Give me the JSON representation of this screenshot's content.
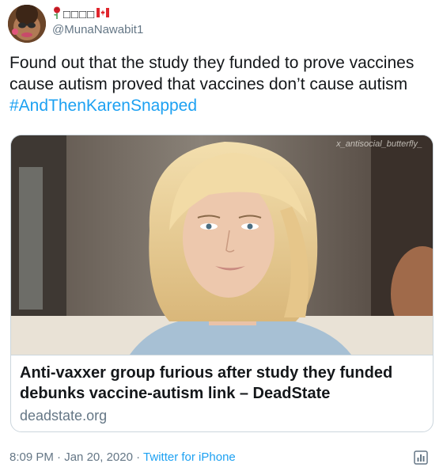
{
  "author": {
    "display_name": "□□□□",
    "handle": "@MunaNawabit1"
  },
  "tweet": {
    "text": "Found out that the study they funded to prove vaccines cause autism proved that vaccines don’t cause autism ",
    "hashtag": "#AndThenKarenSnapped"
  },
  "card": {
    "watermark": "x_antisocial_butterfly_",
    "title": "Anti-vaxxer group furious after study they funded debunks vaccine-autism link – DeadState",
    "domain": "deadstate.org"
  },
  "footer": {
    "time": "8:09 PM",
    "sep1": " · ",
    "date": "Jan 20, 2020",
    "sep2": " · ",
    "source": "Twitter for iPhone"
  },
  "icons": {
    "rose": "rose-icon",
    "flag": "canada-flag-icon",
    "analytics": "analytics-icon"
  },
  "colors": {
    "link": "#1da1f2",
    "secondary": "#657786",
    "border": "#ccd6dd"
  }
}
